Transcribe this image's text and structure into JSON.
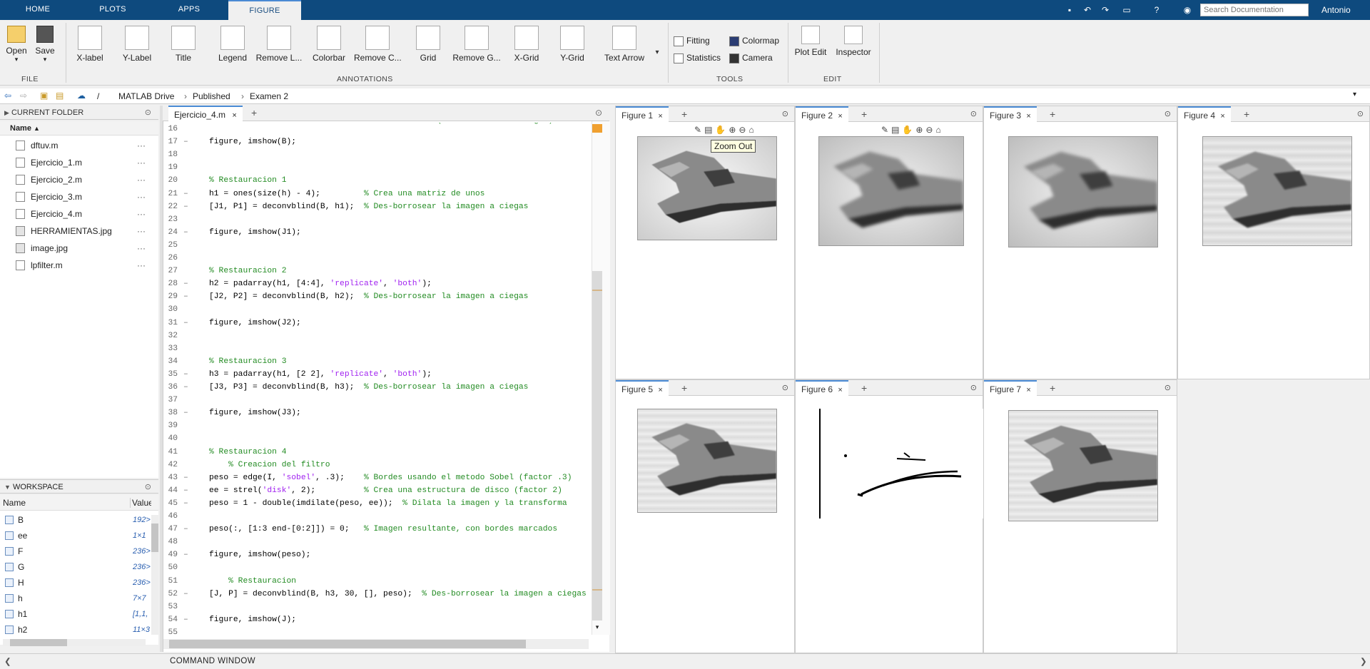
{
  "toptabs": [
    "HOME",
    "PLOTS",
    "APPS",
    "FIGURE"
  ],
  "search_placeholder": "Search Documentation",
  "user": "Antonio",
  "ribbon": {
    "file": {
      "open": "Open",
      "save": "Save",
      "section": "FILE"
    },
    "annotations": {
      "items": [
        "X-label",
        "Y-Label",
        "Title",
        "Legend",
        "Remove L...",
        "Colorbar",
        "Remove C...",
        "Grid",
        "Remove G...",
        "X-Grid",
        "Y-Grid",
        "Text Arrow"
      ],
      "section": "ANNOTATIONS"
    },
    "tools": {
      "fitting": "Fitting",
      "statistics": "Statistics",
      "colormap": "Colormap",
      "camera": "Camera",
      "section": "TOOLS"
    },
    "edit": {
      "plot_edit": "Plot Edit",
      "inspector": "Inspector",
      "section": "EDIT"
    }
  },
  "address": {
    "sep": "/",
    "parts": [
      "MATLAB Drive",
      "Published",
      "Examen 2"
    ]
  },
  "current_folder": {
    "title": "CURRENT FOLDER",
    "column": "Name",
    "files": [
      "dftuv.m",
      "Ejercicio_1.m",
      "Ejercicio_2.m",
      "Ejercicio_3.m",
      "Ejercicio_4.m",
      "HERRAMIENTAS.jpg",
      "image.jpg",
      "lpfilter.m"
    ]
  },
  "workspace": {
    "title": "WORKSPACE",
    "columns": [
      "Name",
      "Value"
    ],
    "vars": [
      {
        "name": "B",
        "value": "192>"
      },
      {
        "name": "ee",
        "value": "1×1"
      },
      {
        "name": "F",
        "value": "236>"
      },
      {
        "name": "G",
        "value": "236>"
      },
      {
        "name": "H",
        "value": "236>"
      },
      {
        "name": "h",
        "value": "7×7"
      },
      {
        "name": "h1",
        "value": "[1,1,"
      },
      {
        "name": "h2",
        "value": "11×3"
      }
    ]
  },
  "editor": {
    "tab": "Ejercicio_4.m",
    "top_partial": "% (Des-borrosear a ciegas)",
    "lines": [
      {
        "n": "16",
        "d": "",
        "c": ""
      },
      {
        "n": "17",
        "d": "–",
        "c": "figure, imshow(B);"
      },
      {
        "n": "18",
        "d": "",
        "c": ""
      },
      {
        "n": "19",
        "d": "",
        "c": ""
      },
      {
        "n": "20",
        "d": "",
        "c": "% Restauracion 1"
      },
      {
        "n": "21",
        "d": "–",
        "c": "h1 = ones(size(h) - 4);         % Crea una matriz de unos"
      },
      {
        "n": "22",
        "d": "–",
        "c": "[J1, P1] = deconvblind(B, h1);  % Des-borrosear la imagen a ciegas"
      },
      {
        "n": "23",
        "d": "",
        "c": ""
      },
      {
        "n": "24",
        "d": "–",
        "c": "figure, imshow(J1);"
      },
      {
        "n": "25",
        "d": "",
        "c": ""
      },
      {
        "n": "26",
        "d": "",
        "c": ""
      },
      {
        "n": "27",
        "d": "",
        "c": "% Restauracion 2"
      },
      {
        "n": "28",
        "d": "–",
        "c": "h2 = padarray(h1, [4:4], 'replicate', 'both');"
      },
      {
        "n": "29",
        "d": "–",
        "c": "[J2, P2] = deconvblind(B, h2);  % Des-borrosear la imagen a ciegas"
      },
      {
        "n": "30",
        "d": "",
        "c": ""
      },
      {
        "n": "31",
        "d": "–",
        "c": "figure, imshow(J2);"
      },
      {
        "n": "32",
        "d": "",
        "c": ""
      },
      {
        "n": "33",
        "d": "",
        "c": ""
      },
      {
        "n": "34",
        "d": "",
        "c": "% Restauracion 3"
      },
      {
        "n": "35",
        "d": "–",
        "c": "h3 = padarray(h1, [2 2], 'replicate', 'both');"
      },
      {
        "n": "36",
        "d": "–",
        "c": "[J3, P3] = deconvblind(B, h3);  % Des-borrosear la imagen a ciegas"
      },
      {
        "n": "37",
        "d": "",
        "c": ""
      },
      {
        "n": "38",
        "d": "–",
        "c": "figure, imshow(J3);"
      },
      {
        "n": "39",
        "d": "",
        "c": ""
      },
      {
        "n": "40",
        "d": "",
        "c": ""
      },
      {
        "n": "41",
        "d": "",
        "c": "% Restauracion 4"
      },
      {
        "n": "42",
        "d": "",
        "c": "    % Creacion del filtro"
      },
      {
        "n": "43",
        "d": "–",
        "c": "peso = edge(I, 'sobel', .3);    % Bordes usando el metodo Sobel (factor .3)"
      },
      {
        "n": "44",
        "d": "–",
        "c": "ee = strel('disk', 2);          % Crea una estructura de disco (factor 2)"
      },
      {
        "n": "45",
        "d": "–",
        "c": "peso = 1 - double(imdilate(peso, ee));  % Dilata la imagen y la transforma"
      },
      {
        "n": "46",
        "d": "",
        "c": ""
      },
      {
        "n": "47",
        "d": "–",
        "c": "peso(:, [1:3 end-[0:2]]) = 0;   % Imagen resultante, con bordes marcados"
      },
      {
        "n": "48",
        "d": "",
        "c": ""
      },
      {
        "n": "49",
        "d": "–",
        "c": "figure, imshow(peso);"
      },
      {
        "n": "50",
        "d": "",
        "c": ""
      },
      {
        "n": "51",
        "d": "",
        "c": "    % Restauracion"
      },
      {
        "n": "52",
        "d": "–",
        "c": "[J, P] = deconvblind(B, h3, 30, [], peso);  % Des-borrosear la imagen a ciegas"
      },
      {
        "n": "53",
        "d": "",
        "c": ""
      },
      {
        "n": "54",
        "d": "–",
        "c": "figure, imshow(J);"
      },
      {
        "n": "55",
        "d": "",
        "c": ""
      }
    ]
  },
  "figures": [
    "Figure 1",
    "Figure 2",
    "Figure 3",
    "Figure 4",
    "Figure 5",
    "Figure 6",
    "Figure 7"
  ],
  "tooltip": "Zoom Out",
  "command_window": "COMMAND WINDOW"
}
